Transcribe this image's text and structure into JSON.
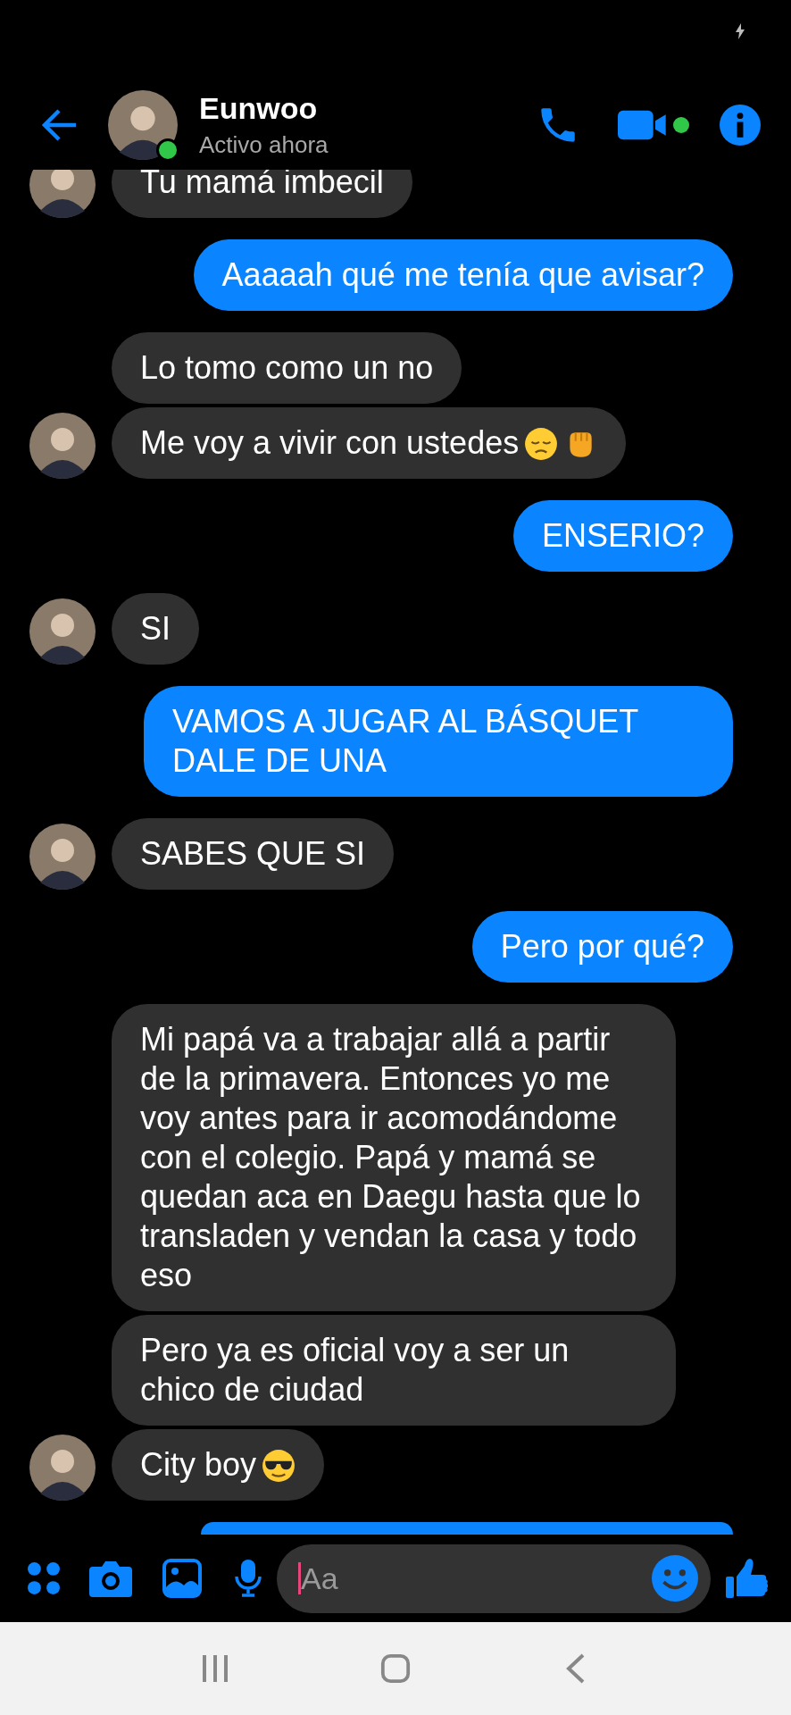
{
  "header": {
    "name": "Eunwoo",
    "status": "Activo ahora",
    "online": true,
    "video_available": true
  },
  "messages": [
    {
      "sent": false,
      "text": "Tu mamá imbecil"
    },
    {
      "sent": true,
      "text": "Aaaaah qué me tenía que avisar?"
    },
    {
      "sent": false,
      "text": "Lo tomo como un no"
    },
    {
      "sent": false,
      "text": "Me voy a vivir con ustedes",
      "emoji": [
        {
          "kind": "pensive"
        },
        {
          "kind": "fist"
        }
      ]
    },
    {
      "sent": true,
      "text": "ENSERIO?"
    },
    {
      "sent": false,
      "text": "SI"
    },
    {
      "sent": true,
      "text": "VAMOS A JUGAR AL BÁSQUET DALE DE UNA"
    },
    {
      "sent": false,
      "text": "SABES QUE SI"
    },
    {
      "sent": true,
      "text": "Pero por qué?"
    },
    {
      "sent": false,
      "text": "Mi papá va a trabajar allá a partir de la primavera. Entonces yo me voy antes para ir acomodándome con el colegio. Papá y mamá se quedan aca en Daegu hasta que lo transladen y vendan la casa y todo eso"
    },
    {
      "sent": false,
      "text": "Pero ya es oficial voy a ser un chico de ciudad"
    },
    {
      "sent": false,
      "text": "City boy",
      "emoji": [
        {
          "kind": "sunglasses"
        }
      ]
    },
    {
      "sent": true,
      "cut_off": true
    }
  ],
  "composer": {
    "placeholder": "Aa"
  }
}
